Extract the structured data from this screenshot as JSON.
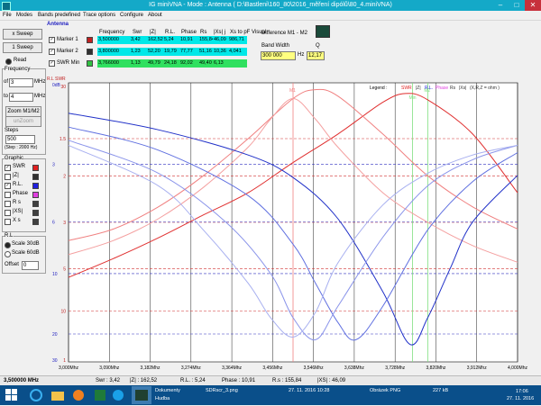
{
  "window": {
    "title": "IG miniVNA - Mode : Antenna ( D:\\Bastleni\\160_80\\2016_měření dipólů\\80_4.miniVNA)"
  },
  "menu": [
    "File",
    "Modes",
    "Bands predefined",
    "Trace options",
    "Configure",
    "About"
  ],
  "controls": {
    "xsweep": "x Sweep",
    "sweep1": "1 Sweep",
    "read": "Read",
    "frequency_label": "Frequency",
    "of": "of",
    "to": "to",
    "mhz": "MHz",
    "freq_from": "3",
    "freq_to": "4",
    "zoom_m1m2": "Zoom M1/M2",
    "unzoom": "unZoom",
    "steps_label": "Steps",
    "steps_value": "500",
    "step_note": "(Step : 2000 Hz)",
    "graphic_label": "Graphic",
    "graphic_items": [
      {
        "label": "SWR",
        "checked": true,
        "color": "#e02020"
      },
      {
        "label": "|Z|",
        "checked": false,
        "color": "#303030"
      },
      {
        "label": "R.L.",
        "checked": true,
        "color": "#2020e0"
      },
      {
        "label": "Phase",
        "checked": false,
        "color": "#e040e0"
      },
      {
        "label": "R s",
        "checked": false,
        "color": "#404040"
      },
      {
        "label": "|XS|",
        "checked": false,
        "color": "#404040"
      },
      {
        "label": "X s",
        "checked": false,
        "color": "#404040"
      }
    ],
    "rl_label": "R.L.",
    "scale30": "Scale 30dB",
    "scale60": "Scale 60dB",
    "offset_label": "Offset",
    "offset_value": "0"
  },
  "antenna": {
    "header": "Antenna",
    "columns": [
      "Frequency",
      "Swr",
      "|Z|",
      "R.L.",
      "Phase",
      "Rs",
      "|Xs| j",
      "Xs to pF Visual"
    ],
    "rows": [
      {
        "label": "Marker 1",
        "values": [
          "3,500000",
          "3,42",
          "162,52",
          "5,24",
          "10,91",
          "155,84",
          "46,09",
          "986,71"
        ]
      },
      {
        "label": "Marker 2",
        "values": [
          "3,800000",
          "1,23",
          "52,20",
          "19,79",
          "77,77",
          "51,16",
          "10,36",
          "4,041"
        ]
      },
      {
        "label": "SWR Min",
        "values": [
          "3,766000",
          "1,13",
          "49,79",
          "24,18",
          "92,02",
          "49,40",
          "6,13",
          ""
        ]
      }
    ],
    "diff_label": "Difference M1 - M2",
    "bandwidth_label": "Band Width",
    "q_label": "Q",
    "bandwidth_value": "300 000",
    "hz": "Hz",
    "q_value": "12,17"
  },
  "chart_data": {
    "type": "line",
    "x_ticks": [
      "3,000Mhz",
      "3,090Mhz",
      "3,182Mhz",
      "3,274Mhz",
      "3,364Mhz",
      "3,456Mhz",
      "3,546Mhz",
      "3,638Mhz",
      "3,728Mhz",
      "3,820Mhz",
      "3,912Mhz",
      "4,000Mhz"
    ],
    "xlim": [
      3.0,
      4.0
    ],
    "swr_ticks": [
      "1",
      "1.5",
      "2",
      "3",
      "5",
      "10",
      "30"
    ],
    "rl_ticks": [
      "0dB",
      "3",
      "6",
      "10",
      "20",
      "30"
    ],
    "legend_title": "Legend :",
    "legend_items": [
      {
        "label": "SWR",
        "color": "#e02020"
      },
      {
        "label": "|Z|",
        "color": "#303030"
      },
      {
        "label": "R.L.",
        "color": "#2020e0"
      },
      {
        "label": "Phase",
        "color": "#e040e0"
      },
      {
        "label": "Rs",
        "color": "#303030"
      },
      {
        "label": "|Xs|",
        "color": "#303030"
      },
      {
        "label": "(X,R,Z = ohm )",
        "color": "#303030"
      }
    ],
    "axis_corner": "R.L SWR",
    "marker_labels": [
      "M1",
      "Min",
      "M2"
    ],
    "marker_freqs": [
      3.5,
      3.766,
      3.8
    ],
    "series": [
      {
        "kind": "swr",
        "color": "#e03030",
        "x": [
          3.0,
          3.1,
          3.2,
          3.3,
          3.4,
          3.5,
          3.6,
          3.7,
          3.75,
          3.8,
          3.9,
          4.0
        ],
        "y": [
          5.6,
          4.4,
          3.5,
          2.8,
          2.3,
          1.8,
          1.45,
          1.15,
          1.08,
          1.13,
          1.45,
          2.3
        ]
      },
      {
        "kind": "swr",
        "color": "#f08080",
        "x": [
          3.0,
          3.1,
          3.2,
          3.3,
          3.4,
          3.5,
          3.55,
          3.6,
          3.7,
          3.8,
          3.9,
          4.0
        ],
        "y": [
          3.6,
          3.2,
          2.6,
          2.0,
          1.5,
          1.12,
          1.05,
          1.1,
          1.45,
          2.0,
          2.6,
          3.2
        ]
      },
      {
        "kind": "swr",
        "color": "#f4a0a0",
        "x": [
          3.0,
          3.1,
          3.2,
          3.3,
          3.4,
          3.45,
          3.5,
          3.55,
          3.6,
          3.7,
          3.8,
          3.9,
          4.0
        ],
        "y": [
          4.2,
          3.6,
          2.9,
          2.2,
          1.6,
          1.3,
          1.12,
          1.3,
          1.6,
          2.3,
          3.0,
          3.8,
          4.6
        ]
      },
      {
        "kind": "rl",
        "color": "#2030c8",
        "x": [
          3.0,
          3.2,
          3.4,
          3.5,
          3.6,
          3.7,
          3.76,
          3.8,
          3.85,
          3.9,
          4.0
        ],
        "y": [
          1.0,
          1.6,
          2.6,
          3.6,
          5.8,
          12.0,
          24.0,
          16.0,
          9.5,
          6.0,
          3.5
        ]
      },
      {
        "kind": "rl",
        "color": "#6070e0",
        "x": [
          3.0,
          3.2,
          3.4,
          3.5,
          3.55,
          3.6,
          3.64,
          3.7,
          3.8,
          3.9,
          4.0
        ],
        "y": [
          1.5,
          2.4,
          4.5,
          7.5,
          11.0,
          17.0,
          22.0,
          14.0,
          6.5,
          3.8,
          2.5
        ]
      },
      {
        "kind": "rl",
        "color": "#8a94ea",
        "x": [
          3.0,
          3.2,
          3.35,
          3.45,
          3.5,
          3.55,
          3.6,
          3.7,
          3.8,
          3.9,
          4.0
        ],
        "y": [
          2.0,
          3.4,
          6.0,
          10.0,
          16.0,
          22.0,
          14.0,
          7.0,
          4.0,
          2.8,
          2.2
        ]
      },
      {
        "kind": "rl",
        "color": "#a8b0f0",
        "x": [
          3.0,
          3.2,
          3.3,
          3.4,
          3.45,
          3.5,
          3.55,
          3.6,
          3.7,
          3.8,
          3.9,
          4.0
        ],
        "y": [
          2.2,
          4.0,
          6.5,
          11.0,
          16.0,
          21.0,
          15.0,
          9.0,
          5.0,
          3.4,
          2.6,
          2.2
        ]
      }
    ]
  },
  "status": {
    "freq": "3,500000 MHz",
    "swr": "Swr : 3,42",
    "z": "|Z| : 162,52",
    "rl": "R.L. : 5,24",
    "phase": "Phase : 10,91",
    "rs": "R.s : 155,84",
    "xs": "|XS| : 46,09"
  },
  "taskbar": {
    "doc_title": "Dokumenty",
    "doc_sub": "Hudba",
    "file": "SDRscr_3.png",
    "date1": "27. 11. 2016 10:28",
    "ftype": "Obrázek PNG",
    "size": "227 kB",
    "time": "17:06",
    "date": "27. 11. 2016"
  }
}
